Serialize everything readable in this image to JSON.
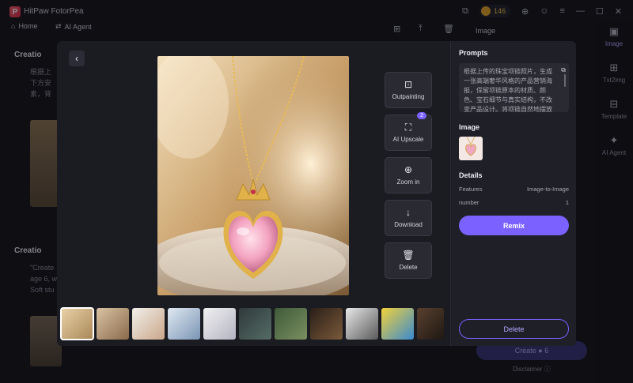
{
  "app": {
    "name": "HitPaw FotorPea",
    "logo_letter": "P",
    "credits": "146"
  },
  "tabs": {
    "home": "Home",
    "ai_agent": "AI Agent"
  },
  "background": {
    "creation_label_1": "Creatio",
    "creation_text_1": [
      "根据上",
      "下方安",
      "素，背"
    ],
    "creation_label_2": "Creatio",
    "creation_text_2": [
      "\"Create",
      "age 6, w",
      "Soft stu"
    ],
    "panel_title": "Image",
    "create_button": "Create",
    "create_cost": "6",
    "disclaimer": "Disclaimer"
  },
  "sidebar": {
    "items": [
      {
        "label": "Image",
        "icon": "image-icon"
      },
      {
        "label": "Txt2img",
        "icon": "text-to-image-icon"
      },
      {
        "label": "Template",
        "icon": "template-icon"
      },
      {
        "label": "AI Agent",
        "icon": "ai-agent-icon"
      }
    ]
  },
  "tools": [
    {
      "label": "Outpainting",
      "icon": "outpainting-icon",
      "glyph": "⊡"
    },
    {
      "label": "AI Upscale",
      "icon": "upscale-icon",
      "glyph": "⛶",
      "badge": "2"
    },
    {
      "label": "Zoom in",
      "icon": "zoom-in-icon",
      "glyph": "⊕"
    },
    {
      "label": "Download",
      "icon": "download-icon",
      "glyph": "↓"
    },
    {
      "label": "Delete",
      "icon": "trash-icon",
      "glyph": "🗑"
    }
  ],
  "details": {
    "prompts_heading": "Prompts",
    "prompt_text": "根据上传的珠宝项链照片，生成一张高端奢华风格的产品营销海报，保留项链原本的材质、颜色、宝石细节与真实结构，不改变产品设计。将项链自然地摆放在高级珠宝广告场景中，营造合适的...",
    "image_heading": "Image",
    "details_heading": "Details",
    "rows": [
      {
        "label": "Features",
        "value": "Image-to-Image"
      },
      {
        "label": "number",
        "value": "1"
      }
    ],
    "remix_label": "Remix",
    "delete_label": "Delete"
  },
  "colors": {
    "accent": "#7b61ff",
    "panel": "#1f1f27",
    "modal": "#1b1b22"
  }
}
